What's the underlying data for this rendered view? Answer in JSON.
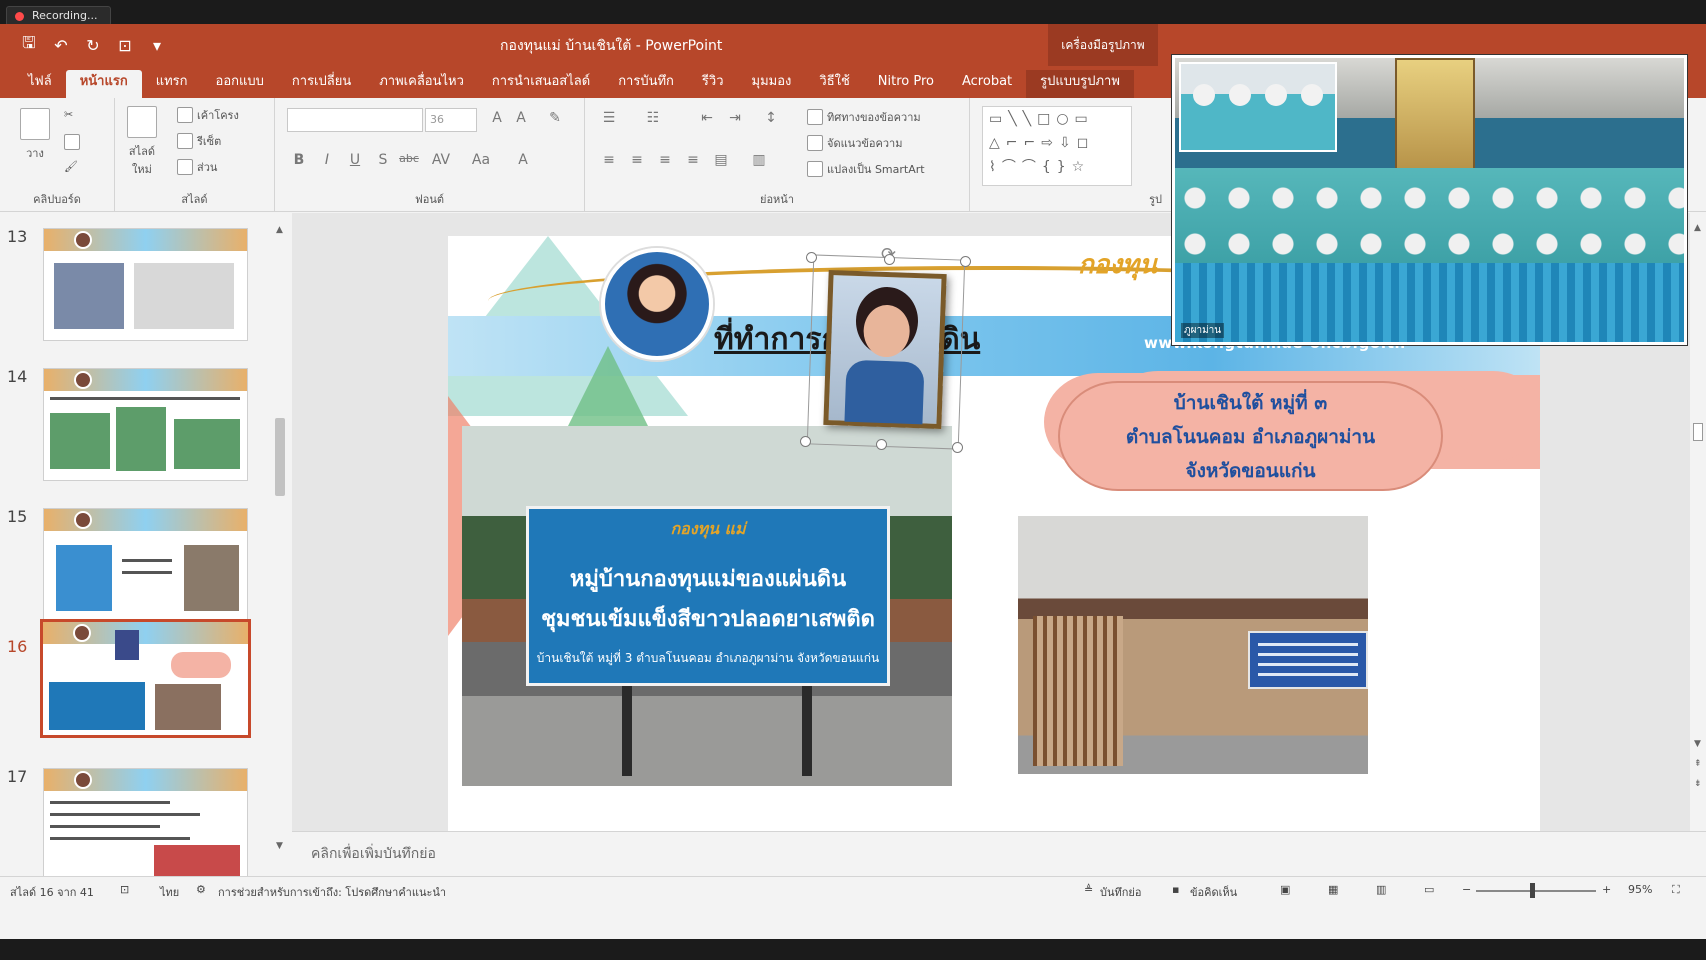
{
  "recording": {
    "label": "Recording..."
  },
  "titlebar": {
    "title": "กองทุนแม่ บ้านเชินใต้  -  PowerPoint",
    "context_title": "เครื่องมือรูปภาพ"
  },
  "tabs": [
    "ไฟล์",
    "หน้าแรก",
    "แทรก",
    "ออกแบบ",
    "การเปลี่ยน",
    "ภาพเคลื่อนไหว",
    "การนำเสนอสไลด์",
    "การบันทึก",
    "รีวิว",
    "มุมมอง",
    "วิธีใช้",
    "Nitro Pro",
    "Acrobat",
    "รูปแบบรูปภาพ"
  ],
  "active_tab": "หน้าแรก",
  "ribbon": {
    "clipboard": {
      "label": "คลิปบอร์ด",
      "paste": "วาง"
    },
    "slides": {
      "label": "สไลด์",
      "new_slide": "สไลด์\nใหม่",
      "layout": "เค้าโครง",
      "reset": "รีเซ็ต",
      "section": "ส่วน"
    },
    "font": {
      "label": "ฟอนต์",
      "font_name": "",
      "font_size": "36"
    },
    "paragraph": {
      "label": "ย่อหน้า",
      "text_direction": "ทิศทางของข้อความ",
      "align_text": "จัดแนวข้อความ",
      "smartart": "แปลงเป็น SmartArt"
    },
    "drawing": {
      "label": "รูป"
    }
  },
  "thumbnails": [
    {
      "num": "13",
      "selected": false
    },
    {
      "num": "14",
      "selected": false
    },
    {
      "num": "15",
      "selected": false
    },
    {
      "num": "16",
      "selected": true
    },
    {
      "num": "17",
      "selected": false
    }
  ],
  "slide": {
    "heading": "ที่ทำการก                  องแผ่นดิน",
    "brand": "กองทุน",
    "website": "www.kongtunmae-oncb.go.th",
    "cloud_lines": [
      "บ้านเชินใต้ หมู่ที่ ๓",
      "ตำบลโนนคอม อำเภอภูผาม่าน",
      "จังหวัดขอนแก่น"
    ],
    "sign_logo": "กองทุน แม่",
    "sign_line1": "หมู่บ้านกองทุนแม่ของแผ่นดิน",
    "sign_line2": "ชุมชนเข้มแข็งสีขาวปลอดยาเสพติด",
    "sign_line3": "บ้านเชินใต้  หมู่ที่ 3  ตำบลโนนคอม  อำเภอภูผาม่าน   จังหวัดขอนแก่น"
  },
  "notes": {
    "placeholder": "คลิกเพื่อเพิ่มบันทึกย่อ"
  },
  "status": {
    "slide_counter": "สไลด์ 16 จาก 41",
    "language": "ไทย",
    "accessibility": "การช่วยสำหรับการเข้าถึง: โปรดศึกษาคำแนะนำ",
    "notes_btn": "บันทึกย่อ",
    "comments_btn": "ข้อคิดเห็น",
    "zoom": "95%"
  },
  "webcam": {
    "label": "ภูผาม่าน"
  },
  "colors": {
    "accent": "#b7472a",
    "selection": "#c7492b"
  }
}
